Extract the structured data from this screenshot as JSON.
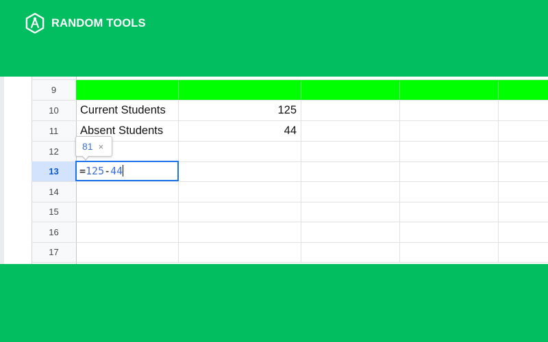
{
  "brand": {
    "name": "RANDOM TOOLS",
    "colors": {
      "banner": "#02BE60",
      "highlight_row": "#00FF00",
      "selection": "#1a73e8"
    }
  },
  "sheet": {
    "rows": [
      {
        "num": "9",
        "a": "",
        "b": ""
      },
      {
        "num": "10",
        "a": "Current Students",
        "b": "125"
      },
      {
        "num": "11",
        "a": "Absent Students",
        "b": "44"
      },
      {
        "num": "12",
        "a": "",
        "b": ""
      },
      {
        "num": "13",
        "a": "",
        "b": ""
      },
      {
        "num": "14",
        "a": "",
        "b": ""
      },
      {
        "num": "15",
        "a": "",
        "b": ""
      },
      {
        "num": "16",
        "a": "",
        "b": ""
      },
      {
        "num": "17",
        "a": "",
        "b": ""
      }
    ],
    "active_row": "13",
    "edit": {
      "eq": "=",
      "n1": "125",
      "op": "-",
      "n2": "44"
    },
    "preview": {
      "value": "81",
      "close": "×"
    }
  }
}
